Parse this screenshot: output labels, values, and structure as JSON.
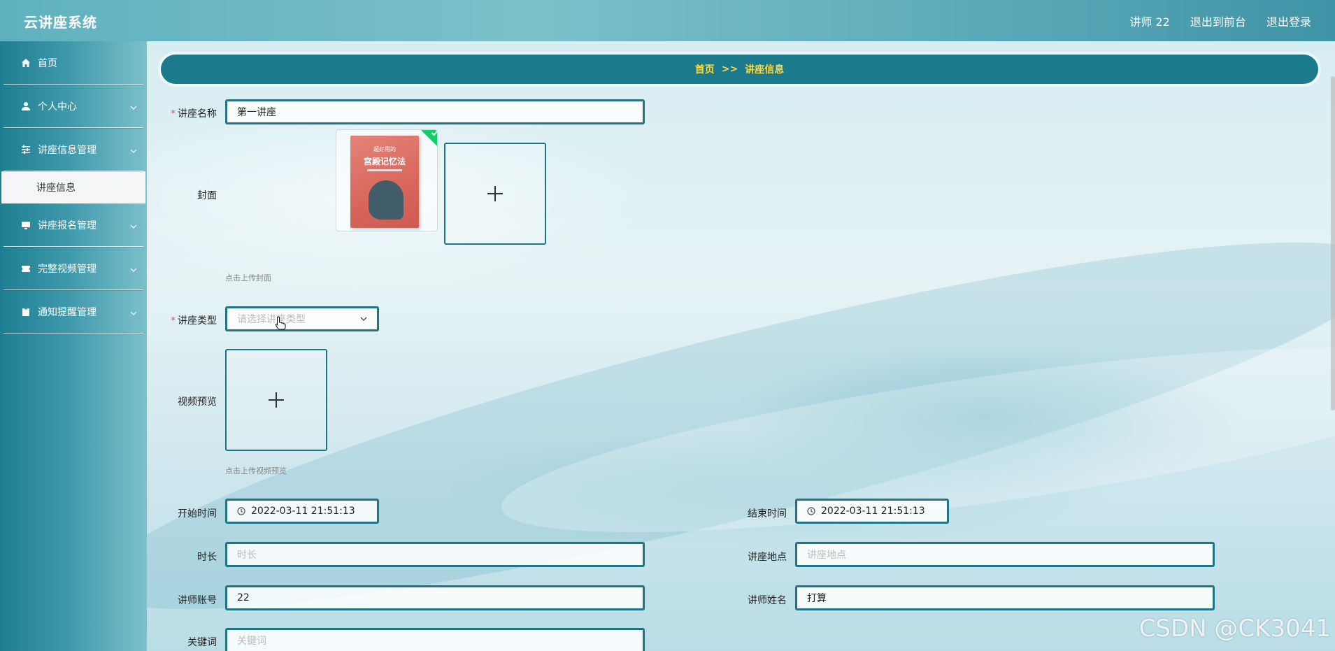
{
  "header": {
    "title": "云讲座系统",
    "user": "讲师 22",
    "back_to_front": "退出到前台",
    "logout": "退出登录"
  },
  "sidebar": {
    "items": [
      {
        "label": "首页",
        "icon": "home-icon"
      },
      {
        "label": "个人中心",
        "icon": "user-icon"
      },
      {
        "label": "讲座信息管理",
        "icon": "sliders-icon",
        "children": [
          {
            "label": "讲座信息"
          }
        ]
      },
      {
        "label": "讲座报名管理",
        "icon": "monitor-icon"
      },
      {
        "label": "完整视频管理",
        "icon": "ticket-icon"
      },
      {
        "label": "通知提醒管理",
        "icon": "clipboard-icon"
      }
    ]
  },
  "breadcrumb": {
    "home": "首页",
    "separator": ">>",
    "current": "讲座信息"
  },
  "form": {
    "name": {
      "label": "讲座名称",
      "value": "第一讲座"
    },
    "cover": {
      "label": "封面",
      "hint": "点击上传封面",
      "book_title": "超好用的",
      "book_main": "宫殿记忆法"
    },
    "type": {
      "label": "讲座类型",
      "placeholder": "请选择讲座类型"
    },
    "video": {
      "label": "视频预览",
      "hint": "点击上传视频预览"
    },
    "start_time": {
      "label": "开始时间",
      "value": "2022-03-11 21:51:13"
    },
    "end_time": {
      "label": "结束时间",
      "value": "2022-03-11 21:51:13"
    },
    "duration": {
      "label": "时长",
      "placeholder": "时长"
    },
    "location": {
      "label": "讲座地点",
      "placeholder": "讲座地点"
    },
    "teacher_account": {
      "label": "讲师账号",
      "value": "22"
    },
    "teacher_name": {
      "label": "讲师姓名",
      "value": "打算"
    },
    "keywords": {
      "label": "关键词",
      "placeholder": "关键词"
    }
  },
  "watermark": "CSDN @CK3041",
  "colors": {
    "accent": "#1f7585",
    "breadcrumb_text": "#ffd93b",
    "required": "#e05050"
  }
}
